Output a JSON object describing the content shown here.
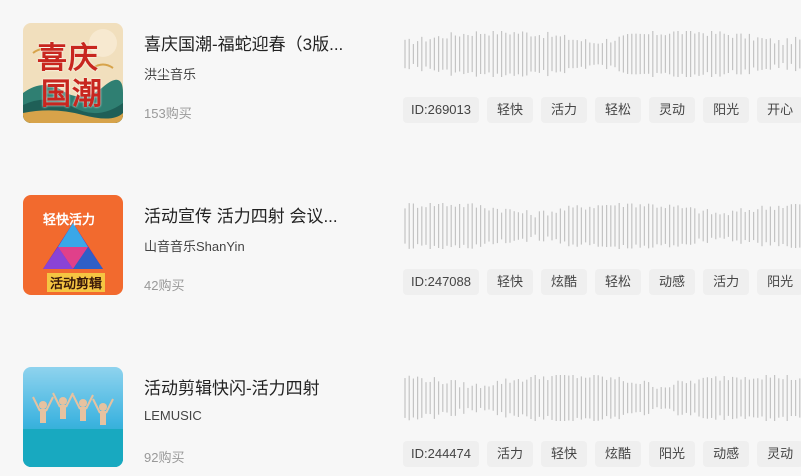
{
  "tracks": [
    {
      "title": "喜庆国潮-福蛇迎春（3版...",
      "author": "洪尘音乐",
      "sales": "153购买",
      "id_label": "ID:269013",
      "tags": [
        "轻快",
        "活力",
        "轻松",
        "灵动",
        "阳光",
        "开心"
      ],
      "cover_text": [
        "喜庆",
        "国潮"
      ],
      "cover_colors": [
        "#f3e3c3",
        "#c8261f",
        "#2b7c6f"
      ]
    },
    {
      "title": "活动宣传 活力四射 会议...",
      "author": "山音音乐ShanYin",
      "sales": "42购买",
      "id_label": "ID:247088",
      "tags": [
        "轻快",
        "炫酷",
        "轻松",
        "动感",
        "活力",
        "阳光"
      ],
      "cover_text": [
        "轻快活力",
        "活动剪辑"
      ],
      "cover_colors": [
        "#f26a2e",
        "#ffffff",
        "#6b2fb3"
      ]
    },
    {
      "title": "活动剪辑快闪-活力四射",
      "author": "LEMUSIC",
      "sales": "92购买",
      "id_label": "ID:244474",
      "tags": [
        "活力",
        "轻快",
        "炫酷",
        "阳光",
        "动感",
        "灵动"
      ],
      "cover_text": [],
      "cover_colors": [
        "#3fb4e0",
        "#1fa6b8",
        "#e9c9a8"
      ]
    }
  ]
}
